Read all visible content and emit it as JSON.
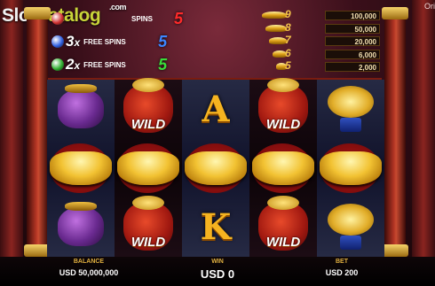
{
  "watermark": {
    "slot": "Slot",
    "catalog": "Catalog",
    "com": ".com"
  },
  "top_right_text": "Ori",
  "free_spins": [
    {
      "multiplier": "",
      "label": "SPINS",
      "spins": "5",
      "gem_color": "#d03030",
      "spins_color": "#ff2a2a"
    },
    {
      "multiplier": "3",
      "label": "FREE SPINS",
      "spins": "5",
      "gem_color": "#3060e0",
      "spins_color": "#3c86ff"
    },
    {
      "multiplier": "2",
      "label": "FREE SPINS",
      "spins": "5",
      "gem_color": "#30b030",
      "spins_color": "#3adc3a"
    }
  ],
  "paytable": [
    {
      "count": "9",
      "value": "100,000"
    },
    {
      "count": "8",
      "value": "50,000"
    },
    {
      "count": "7",
      "value": "20,000"
    },
    {
      "count": "6",
      "value": "6,000"
    },
    {
      "count": "5",
      "value": "2,000"
    }
  ],
  "reels": [
    [
      {
        "sym": "pot"
      },
      {
        "sym": "ingot"
      },
      {
        "sym": "pot"
      }
    ],
    [
      {
        "sym": "bag",
        "wild": "WILD"
      },
      {
        "sym": "ingot"
      },
      {
        "sym": "bag",
        "wild": "WILD"
      }
    ],
    [
      {
        "sym": "letter",
        "text": "A"
      },
      {
        "sym": "ingot"
      },
      {
        "sym": "letter",
        "text": "K"
      }
    ],
    [
      {
        "sym": "bag",
        "wild": "WILD"
      },
      {
        "sym": "ingot"
      },
      {
        "sym": "bag",
        "wild": "WILD"
      }
    ],
    [
      {
        "sym": "tree"
      },
      {
        "sym": "ingot"
      },
      {
        "sym": "tree"
      }
    ]
  ],
  "bottom": {
    "balance_label": "BALANCE",
    "balance_value": "USD 50,000,000",
    "win_label": "WIN",
    "win_value": "USD 0",
    "bet_label": "BET",
    "bet_value": "USD 200"
  }
}
